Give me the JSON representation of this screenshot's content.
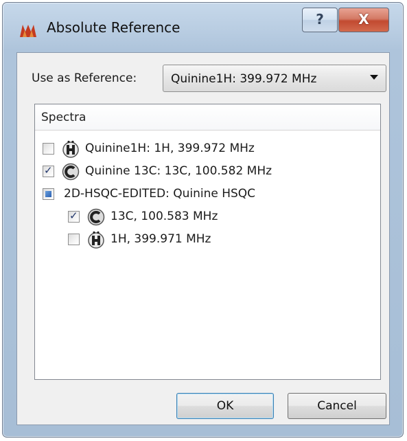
{
  "window": {
    "title": "Absolute Reference",
    "help_label": "?",
    "close_label": "X"
  },
  "reference": {
    "label": "Use as Reference:",
    "selected": "Quinine1H: 399.972 MHz"
  },
  "spectra": {
    "header": "Spectra",
    "items": [
      {
        "label": "Quinine1H: 1H, 399.972 MHz",
        "checked": false,
        "icon": "proton-icon",
        "level": 0
      },
      {
        "label": "Quinine 13C: 13C, 100.582 MHz",
        "checked": true,
        "icon": "carbon-icon",
        "level": 0
      },
      {
        "label": "2D-HSQC-EDITED: Quinine HSQC",
        "checked": "partial",
        "icon": null,
        "level": 0
      },
      {
        "label": "13C, 100.583 MHz",
        "checked": true,
        "icon": "carbon-icon",
        "level": 1
      },
      {
        "label": "1H, 399.971 MHz",
        "checked": false,
        "icon": "proton-icon",
        "level": 1
      }
    ]
  },
  "buttons": {
    "ok": "OK",
    "cancel": "Cancel"
  },
  "colors": {
    "frame": "#b9cde2",
    "close_button": "#c24a31",
    "client": "#f0f0f0",
    "ok_border": "#3c7fb1"
  }
}
